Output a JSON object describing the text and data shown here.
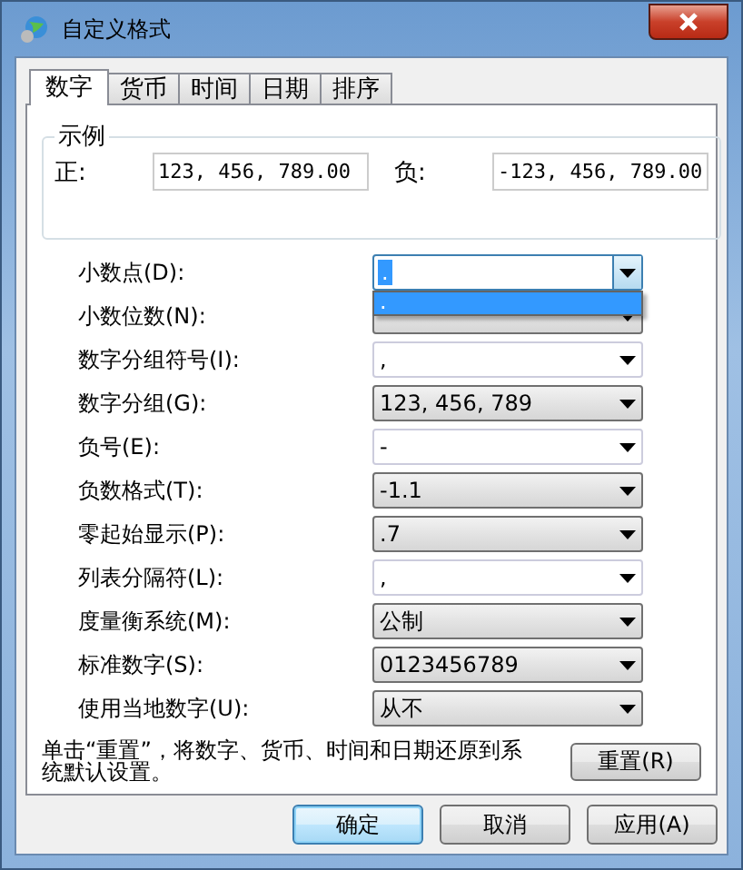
{
  "window": {
    "title": "自定义格式"
  },
  "tabs": [
    {
      "label": "数字",
      "selected": true
    },
    {
      "label": "货币",
      "selected": false
    },
    {
      "label": "时间",
      "selected": false
    },
    {
      "label": "日期",
      "selected": false
    },
    {
      "label": "排序",
      "selected": false
    }
  ],
  "example": {
    "title": "示例",
    "positive_label": "正:",
    "positive_value": "123, 456, 789.00",
    "negative_label": "负:",
    "negative_value": "-123, 456, 789.00"
  },
  "settings": [
    {
      "label": "小数点(D):",
      "value": ".",
      "kind": "combo",
      "expanded": true,
      "options": [
        {
          "label": ".",
          "selected": true
        }
      ]
    },
    {
      "label": "小数位数(N):",
      "kind": "list",
      "expanded": false
    },
    {
      "label": "数字分组符号(I):",
      "value": ",",
      "kind": "combo",
      "expanded": false
    },
    {
      "label": "数字分组(G):",
      "value": "123, 456, 789",
      "kind": "list",
      "expanded": false
    },
    {
      "label": "负号(E):",
      "value": "-",
      "kind": "combo",
      "expanded": false
    },
    {
      "label": "负数格式(T):",
      "value": "-1.1",
      "kind": "list",
      "expanded": false
    },
    {
      "label": "零起始显示(P):",
      "value": ".7",
      "kind": "list",
      "expanded": false
    },
    {
      "label": "列表分隔符(L):",
      "value": ",",
      "kind": "combo",
      "expanded": false
    },
    {
      "label": "度量衡系统(M):",
      "value": "公制",
      "kind": "list",
      "expanded": false
    },
    {
      "label": "标准数字(S):",
      "value": "0123456789",
      "kind": "list",
      "expanded": false
    },
    {
      "label": "使用当地数字(U):",
      "value": "从不",
      "kind": "list",
      "expanded": false
    }
  ],
  "reset_note": "单击“重置”，将数字、货币、时间和日期还原到系统默认设置。",
  "reset_button": "重置(R)",
  "buttons": [
    {
      "label": "确定",
      "default": true
    },
    {
      "label": "取消",
      "default": false
    },
    {
      "label": "应用(A)",
      "default": false
    }
  ]
}
